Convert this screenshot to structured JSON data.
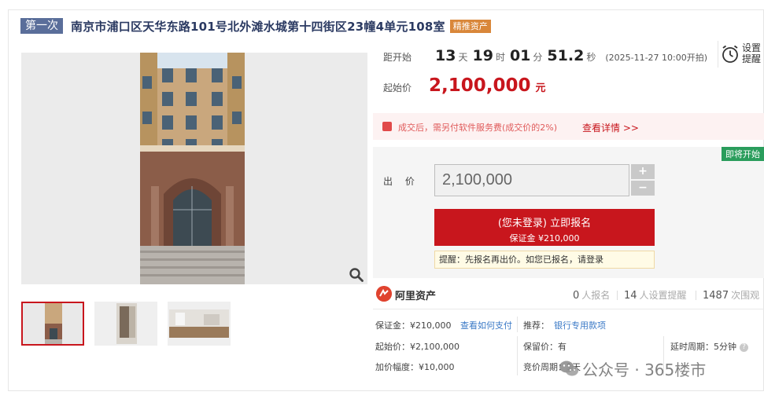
{
  "title": {
    "round_tag": "第一次",
    "address": "南京市浦口区天华东路101号北外滩水城第十四街区23幢4单元108室",
    "asset_tag": "精推资产"
  },
  "countdown": {
    "label": "距开始",
    "days": "13",
    "days_unit": "天",
    "hours": "19",
    "hours_unit": "时",
    "minutes": "01",
    "minutes_unit": "分",
    "seconds": "51.2",
    "seconds_unit": "秒",
    "start_time": "(2025-11-27 10:00开拍)"
  },
  "reminder": {
    "line1": "设置",
    "line2": "提醒"
  },
  "start_price": {
    "label": "起始价",
    "value": "2,100,000",
    "unit": "元"
  },
  "fee_notice": {
    "text": "成交后，需另付软件服务费(成交价的2%)",
    "link": "查看详情 >>"
  },
  "bid": {
    "status_tag": "即将开始",
    "label": "出 价",
    "value": "2,100,000",
    "plus": "+",
    "minus": "−",
    "signup_main": "(您未登录) 立即报名",
    "signup_sub": "保证金 ¥210,000",
    "tip": "提醒：先报名再出价。如您已报名，请登录"
  },
  "platform": {
    "name": "阿里资产",
    "signups": "0",
    "signups_label": "人报名",
    "reminders": "14",
    "reminders_label": "人设置提醒",
    "views": "1487",
    "views_label": "次围观"
  },
  "details": {
    "deposit_label": "保证金：",
    "deposit_value": "¥210,000",
    "deposit_link": "查看如何支付",
    "recommend_label": "推荐：",
    "recommend_link": "银行专用款项",
    "start_price": "起始价：¥2,100,000",
    "reserve": "保留价：有",
    "extension": "延时周期：5分钟",
    "increment": "加价幅度：¥10,000",
    "cycle": "竞价周期：1天"
  },
  "watermark": "公众号 · 365楼市",
  "icons": {
    "alarm": "alarm-clock-icon",
    "zoom": "magnifier-icon",
    "fee": "gift-icon",
    "logo": "alibaba-asset-logo",
    "help": "question-icon",
    "wechat": "wechat-icon"
  },
  "colors": {
    "accent_red": "#c8161d",
    "title_navy": "#2b3a62",
    "round_tag": "#5a6e9a",
    "asset_tag": "#d9873a",
    "status_green": "#2a9d5c",
    "link_blue": "#3a79c6"
  }
}
